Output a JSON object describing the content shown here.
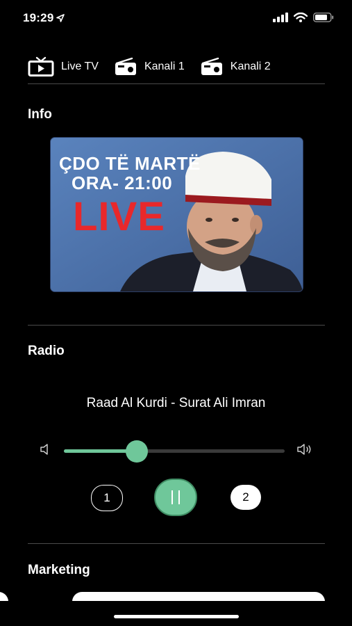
{
  "status_bar": {
    "time": "19:29"
  },
  "tabs": [
    {
      "label": "Live TV",
      "icon": "tv-icon"
    },
    {
      "label": "Kanali 1",
      "icon": "radio-icon"
    },
    {
      "label": "Kanali 2",
      "icon": "radio-icon"
    }
  ],
  "sections": {
    "info": "Info",
    "radio": "Radio",
    "marketing": "Marketing"
  },
  "info_card": {
    "line1": "ÇDO TË MARTË",
    "line2": "ORA- 21:00",
    "line3": "LIVE",
    "accent_color": "#e8282b"
  },
  "radio": {
    "track": "Raad Al Kurdi - Surat Ali Imran",
    "volume_fraction": 0.33,
    "channel_1": "1",
    "channel_2": "2",
    "accent_color": "#6fc79a"
  }
}
